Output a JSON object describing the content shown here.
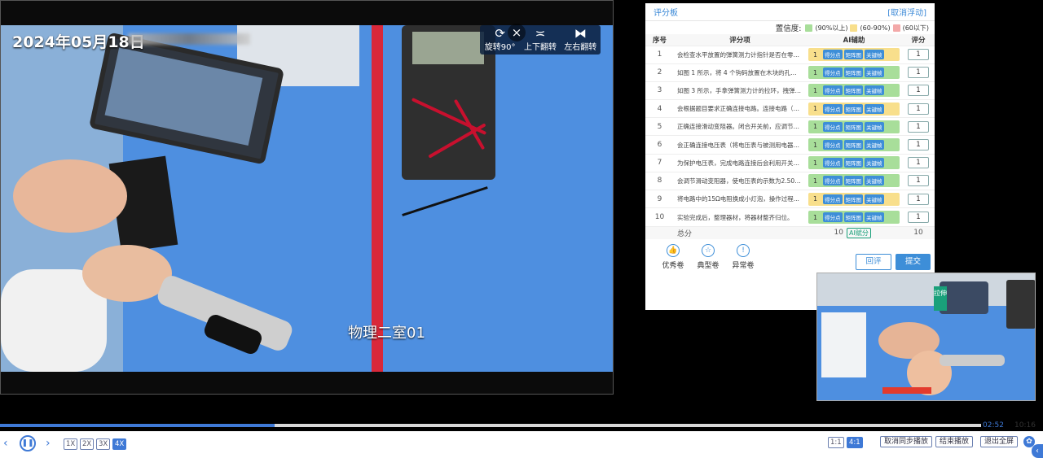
{
  "video": {
    "timestamp": "2024年05月18日",
    "room_label": "物理二室01",
    "tools": [
      {
        "icon": "rotate-icon",
        "label": "旋转90°"
      },
      {
        "icon": "flip-vertical-icon",
        "label": "上下翻转"
      },
      {
        "icon": "flip-horizontal-icon",
        "label": "左右翻转"
      }
    ],
    "close_glyph": "×"
  },
  "panel": {
    "title": "评分板",
    "cancel_float": "[取消浮动]",
    "confidence_label": "置信度:",
    "legend": [
      {
        "color": "#a8de9a",
        "text": "(90%以上)"
      },
      {
        "color": "#f8df8c",
        "text": "(60-90%)"
      },
      {
        "color": "#f3a9a9",
        "text": "(60以下)"
      }
    ],
    "headers": {
      "no": "序号",
      "item": "评分项",
      "ai": "AI辅助",
      "score": "评分"
    },
    "ai_tags": [
      "得分点",
      "矩阵图",
      "关键帧"
    ],
    "rows": [
      {
        "no": "1",
        "text": "会检查水平放置的弹簧测力计指针是否在零刻...",
        "ai_score": "1",
        "ai_color": "#f8df8c",
        "score": "1"
      },
      {
        "no": "2",
        "text": "如图 1 所示，将 4 个钩码放置在木块的孔中，把...",
        "ai_score": "1",
        "ai_color": "#a8de9a",
        "score": "1"
      },
      {
        "no": "3",
        "text": "如图 3 所示，手拿弹簧测力计的拉环，拽弹簧测力...",
        "ai_score": "1",
        "ai_color": "#a8de9a",
        "score": "1"
      },
      {
        "no": "4",
        "text": "会根据题目要求正确连接电路。连接电路（包括更...",
        "ai_score": "1",
        "ai_color": "#f8df8c",
        "score": "1"
      },
      {
        "no": "5",
        "text": "正确连接滑动变阻器。闭合开关前，应调节滑动...",
        "ai_score": "1",
        "ai_color": "#a8de9a",
        "score": "1"
      },
      {
        "no": "6",
        "text": "会正确连接电压表（将电压表与被测用电器并联...",
        "ai_score": "1",
        "ai_color": "#a8de9a",
        "score": "1"
      },
      {
        "no": "7",
        "text": "为保护电压表，完成电路连接后会利用开关进行...",
        "ai_score": "1",
        "ai_color": "#a8de9a",
        "score": "1"
      },
      {
        "no": "8",
        "text": "会调节滑动变阻器，使电压表的示数为2.50V。",
        "ai_score": "1",
        "ai_color": "#a8de9a",
        "score": "1"
      },
      {
        "no": "9",
        "text": "将电路中的15Ω电阻换成小灯泡，操作过程...",
        "ai_score": "1",
        "ai_color": "#f8df8c",
        "score": "1"
      },
      {
        "no": "10",
        "text": "实验完成后，整理器材，将器材整齐归位。",
        "ai_score": "1",
        "ai_color": "#a8de9a",
        "score": "1"
      }
    ],
    "total_label": "总分",
    "total_ai": "10",
    "ai_grade_btn": "AI赋分",
    "total_score": "10",
    "actions": [
      {
        "icon": "thumbs-up-icon",
        "glyph": "👍",
        "label": "优秀卷"
      },
      {
        "icon": "star-icon",
        "glyph": "☆",
        "label": "典型卷"
      },
      {
        "icon": "alert-icon",
        "glyph": "!",
        "label": "异常卷"
      }
    ],
    "back_btn": "回评",
    "submit_btn": "提交"
  },
  "pip": {
    "side_label": "拉伸"
  },
  "player": {
    "progress": 0.28,
    "current_time": "02:52",
    "total_time": "10:16",
    "speeds": [
      "1X",
      "2X",
      "3X",
      "4X"
    ],
    "selected_speed": "4X",
    "ratios": [
      "1:1",
      "4:1"
    ],
    "selected_ratio": "4:1",
    "cancel_sync": "取消同步播放",
    "end_play": "结束播放",
    "exit_fullscreen": "退出全屏"
  }
}
